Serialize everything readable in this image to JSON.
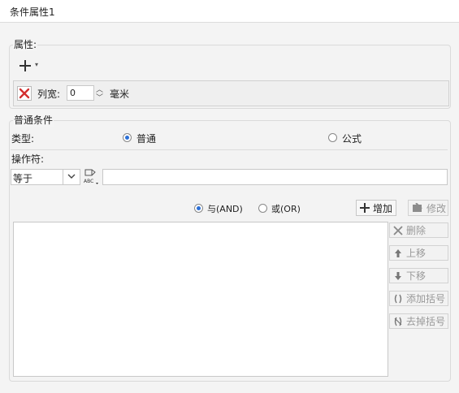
{
  "window": {
    "title": "条件属性1"
  },
  "attributes": {
    "legend": "属性:",
    "add_icon": "plus-icon",
    "column_width_label": "列宽:",
    "column_width_value": "0",
    "unit": "毫米"
  },
  "conditions": {
    "legend": "普通条件",
    "type_label": "类型:",
    "type_options": [
      "普通",
      "公式"
    ],
    "type_selected": "普通",
    "operator_label": "操作符:",
    "operator_value": "等于",
    "value_input": "",
    "logic_options": [
      "与(AND)",
      "或(OR)"
    ],
    "logic_selected": "与(AND)",
    "buttons": {
      "add": "增加",
      "modify": "修改",
      "delete": "删除",
      "up": "上移",
      "down": "下移",
      "add_bracket": "添加括号",
      "remove_bracket": "去掉括号"
    },
    "colors": {
      "accent": "#2b6fd6",
      "delete_red": "#d32f2f"
    }
  }
}
